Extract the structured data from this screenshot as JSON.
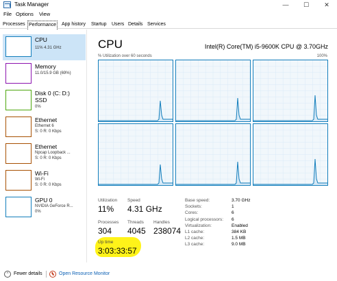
{
  "window": {
    "title": "Task Manager",
    "minimize_glyph": "—",
    "maximize_glyph": "☐",
    "close_glyph": "✕"
  },
  "menu": [
    "File",
    "Options",
    "View"
  ],
  "tabs": [
    "Processes",
    "Performance",
    "App history",
    "Startup",
    "Users",
    "Details",
    "Services"
  ],
  "active_tab": "Performance",
  "sidebar": [
    {
      "title": "CPU",
      "sub1": "11% 4.31 GHz",
      "sub2": "",
      "color": "#117dbb"
    },
    {
      "title": "Memory",
      "sub1": "11.0/15.9 GB (69%)",
      "sub2": "",
      "color": "#8b12ae"
    },
    {
      "title": "Disk 0 (C: D:)",
      "sub1": "SSD",
      "sub2": "0%",
      "color": "#4da60c"
    },
    {
      "title": "Ethernet",
      "sub1": "Ethernet 6",
      "sub2": "S: 0 R: 0 Kbps",
      "color": "#a74f01"
    },
    {
      "title": "Ethernet",
      "sub1": "Npcap Loopback ...",
      "sub2": "S: 0 R: 0 Kbps",
      "color": "#a74f01"
    },
    {
      "title": "Wi-Fi",
      "sub1": "Wi-Fi",
      "sub2": "S: 0 R: 0 Kbps",
      "color": "#a74f01"
    },
    {
      "title": "GPU 0",
      "sub1": "NVIDIA GeForce R...",
      "sub2": "0%",
      "color": "#117dbb"
    }
  ],
  "main": {
    "title": "CPU",
    "model": "Intel(R) Core(TM) i5-9600K CPU @ 3.70GHz",
    "util_label": "% Utilization over 60 seconds",
    "util_max": "100%",
    "graph_color": "#117dbb"
  },
  "stats": {
    "utilization_label": "Utilization",
    "utilization": "11%",
    "speed_label": "Speed",
    "speed": "4.31 GHz",
    "processes_label": "Processes",
    "processes": "304",
    "threads_label": "Threads",
    "threads": "4045",
    "handles_label": "Handles",
    "handles": "238074",
    "uptime_label": "Up time",
    "uptime": "3:03:33:57",
    "highlight_color": "#fff200"
  },
  "details": [
    {
      "label": "Base speed:",
      "value": "3.70 GHz"
    },
    {
      "label": "Sockets:",
      "value": "1"
    },
    {
      "label": "Cores:",
      "value": "6"
    },
    {
      "label": "Logical processors:",
      "value": "6"
    },
    {
      "label": "Virtualization:",
      "value": "Enabled"
    },
    {
      "label": "L1 cache:",
      "value": "384 KB"
    },
    {
      "label": "L2 cache:",
      "value": "1.5 MB"
    },
    {
      "label": "L3 cache:",
      "value": "9.0 MB"
    }
  ],
  "footer": {
    "fewer_details": "Fewer details",
    "open_resource_monitor": "Open Resource Monitor"
  }
}
